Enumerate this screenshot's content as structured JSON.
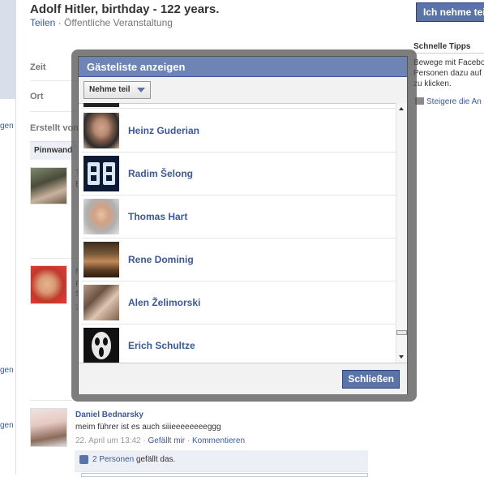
{
  "event": {
    "title": "Adolf Hitler, birthday - 122 years.",
    "share": "Teilen",
    "separator": "·",
    "type": "Öffentliche Veranstaltung"
  },
  "info": {
    "time_label": "Zeit",
    "place_label": "Ort",
    "created_label": "Erstellt von"
  },
  "wall_tab": "Pinnwand",
  "join_button": "Ich nehme teil",
  "tips": {
    "title": "Schnelle Tipps",
    "text": "Bewege mit Facebook Personen dazu auf ... zu klicken.",
    "line1": "Bewege mit Facebo",
    "line2": "Personen dazu auf",
    "line3": "zu klicken.",
    "link": "Steigere die An"
  },
  "left_links": [
    "gen",
    "gen",
    "gen"
  ],
  "partials": {
    "p1a": "T",
    "p1b": "B",
    "p2a": "M",
    "p2b": "P",
    "p2c": "S",
    "p2d": "2"
  },
  "post": {
    "author": "Daniel Bednarsky",
    "text": "meim führer ist es auch siiieeeeeeeeggg",
    "date": "22. April um 13:42",
    "dot": "·",
    "like": "Gefällt mir",
    "comment": "Kommentieren",
    "likes_count": "2 Personen",
    "likes_suffix": "gefällt das."
  },
  "dialog": {
    "title": "Gästeliste anzeigen",
    "filter": "Nehme teil",
    "close": "Schließen",
    "guests": [
      {
        "name": "Heinz Guderian",
        "pic": "p-guderian"
      },
      {
        "name": "Radim Šelong",
        "pic": "p-selong"
      },
      {
        "name": "Thomas Hart",
        "pic": "p-hart"
      },
      {
        "name": "Rene Dominig",
        "pic": "p-dominig"
      },
      {
        "name": "Alen Želimorski",
        "pic": "p-zelimorski"
      },
      {
        "name": "Erich Schultze",
        "pic": "p-schultze"
      }
    ]
  }
}
